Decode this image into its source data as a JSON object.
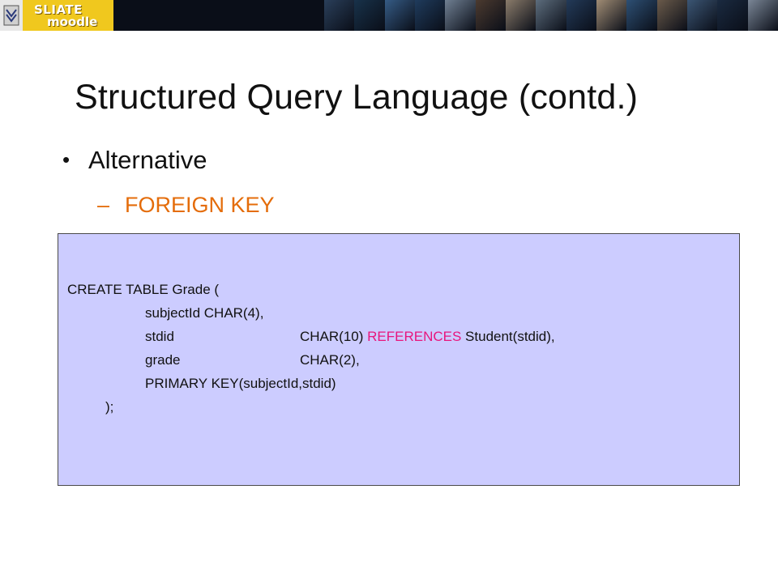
{
  "banner": {
    "brand_top": "SLIATE",
    "brand_bottom": "moodle",
    "colors": {
      "bar": "#0a0e18",
      "brand_panel": "#f0c81e"
    },
    "collage_tiles": [
      "#2a3f5a",
      "#18324a",
      "#355b85",
      "#1f3b5c",
      "#6f7f92",
      "#4b3a2f",
      "#8a7b6a",
      "#5c6c7c",
      "#233a58",
      "#a08c74",
      "#2d4f73",
      "#6a5a4a",
      "#3b5573",
      "#1a2a40",
      "#7a8696"
    ]
  },
  "slide": {
    "title": "Structured Query Language (contd.)",
    "bullet_level1": {
      "marker": "•",
      "text": "Alternative"
    },
    "bullet_level2": {
      "marker": "–",
      "text": "FOREIGN KEY",
      "color": "#e46c0a"
    }
  },
  "code": {
    "background": "#ccccff",
    "keyword_color": "#e8157c",
    "line1": "CREATE TABLE Grade (",
    "line2": "subjectId CHAR(4),",
    "line3_col": "stdid",
    "line3_type": "CHAR(10)",
    "line3_keyword": "REFERENCES",
    "line3_rest": " Student(stdid),",
    "line4_col": "grade",
    "line4_type": "CHAR(2),",
    "line5": "PRIMARY KEY(subjectId,stdid)",
    "line6": ");"
  }
}
